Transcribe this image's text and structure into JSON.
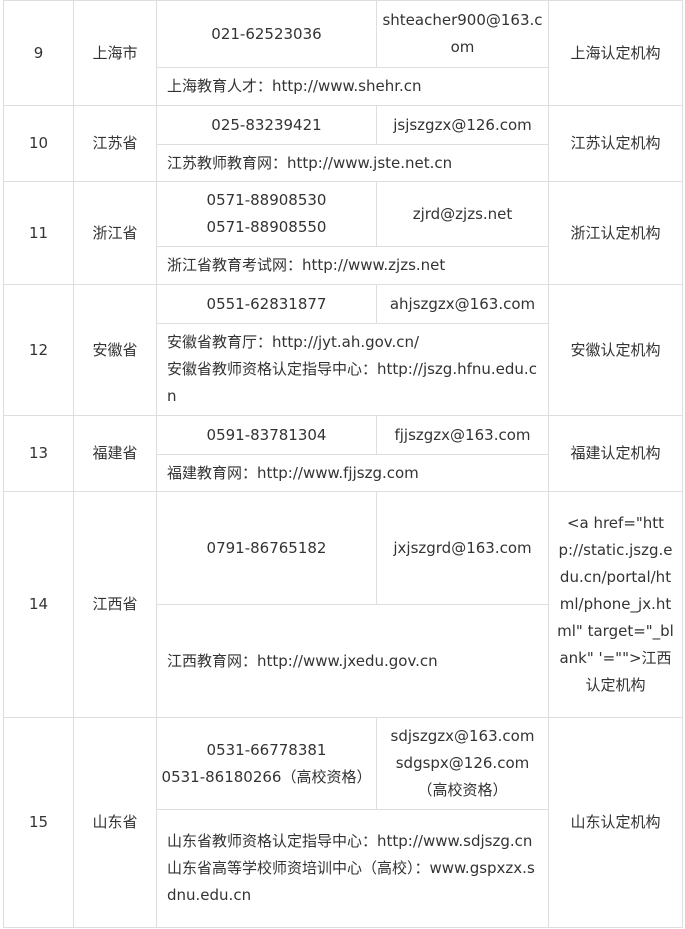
{
  "rows": [
    {
      "no": "9",
      "province": "上海市",
      "phones": [
        "021-62523036"
      ],
      "emails": [
        "shteacher900@163.com"
      ],
      "websites": [
        "上海教育人才：http://www.shehr.cn"
      ],
      "org": "上海认定机构"
    },
    {
      "no": "10",
      "province": "江苏省",
      "phones": [
        "025-83239421"
      ],
      "emails": [
        "jsjszgzx@126.com"
      ],
      "websites": [
        "江苏教师教育网：http://www.jste.net.cn"
      ],
      "org": "江苏认定机构"
    },
    {
      "no": "11",
      "province": "浙江省",
      "phones": [
        "0571-88908530",
        "0571-88908550"
      ],
      "emails": [
        "zjrd@zjzs.net"
      ],
      "websites": [
        "浙江省教育考试网：http://www.zjzs.net"
      ],
      "org": "浙江认定机构"
    },
    {
      "no": "12",
      "province": "安徽省",
      "phones": [
        "0551-62831877"
      ],
      "emails": [
        "ahjszgzx@163.com"
      ],
      "websites": [
        "安徽省教育厅：http://jyt.ah.gov.cn/",
        "安徽省教师资格认定指导中心：http://jszg.hfnu.edu.cn"
      ],
      "org": "安徽认定机构"
    },
    {
      "no": "13",
      "province": "福建省",
      "phones": [
        "0591-83781304"
      ],
      "emails": [
        "fjjszgzx@163.com"
      ],
      "websites": [
        "福建教育网：http://www.fjjszg.com"
      ],
      "org": "福建认定机构"
    },
    {
      "no": "14",
      "province": "江西省",
      "phones": [
        "0791-86765182"
      ],
      "emails": [
        "jxjszgrd@163.com"
      ],
      "websites": [
        "江西教育网：http://www.jxedu.gov.cn"
      ],
      "org": "<a href=\"http://static.jszg.edu.cn/portal/html/phone_jx.html\" target=\"_blank\" '=\"\">江西认定机构"
    },
    {
      "no": "15",
      "province": "山东省",
      "phones": [
        "0531-66778381",
        "0531-86180266（高校资格）"
      ],
      "emails": [
        "sdjszgzx@163.com",
        "sdgspx@126.com",
        "（高校资格）"
      ],
      "websites": [
        "山东省教师资格认定指导中心：http://www.sdjszg.cn",
        "山东省高等学校师资培训中心（高校）：www.gspxzx.sdnu.edu.cn"
      ],
      "org": "山东认定机构"
    }
  ]
}
